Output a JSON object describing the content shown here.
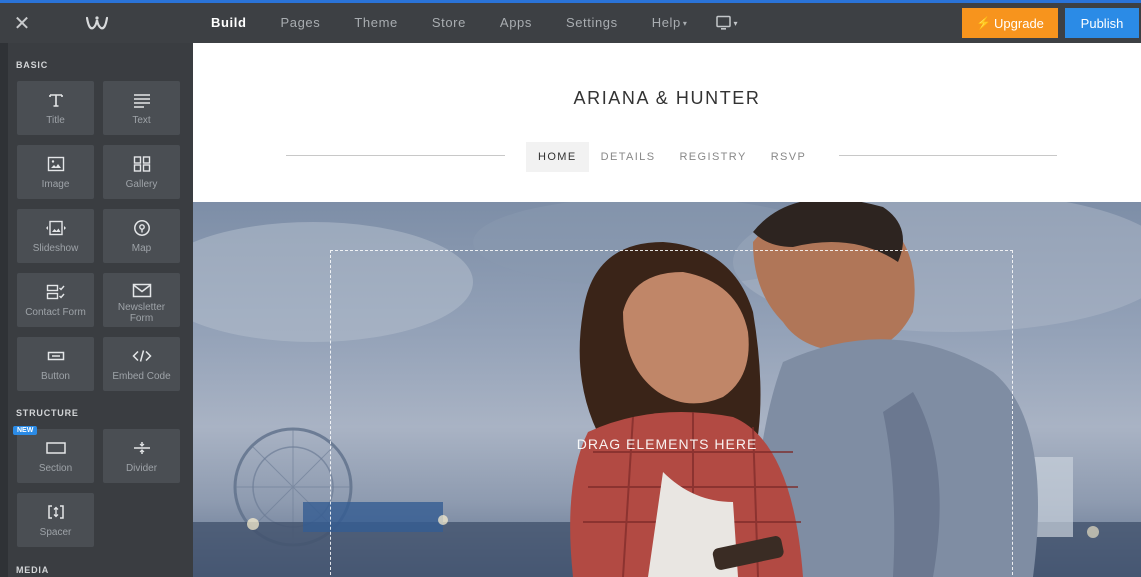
{
  "topbar": {
    "close_icon": "close-icon",
    "logo_icon": "weebly-logo-icon",
    "tabs": [
      {
        "label": "Build",
        "active": true
      },
      {
        "label": "Pages"
      },
      {
        "label": "Theme"
      },
      {
        "label": "Store"
      },
      {
        "label": "Apps"
      },
      {
        "label": "Settings"
      },
      {
        "label": "Help"
      }
    ],
    "device_icon": "monitor-icon",
    "upgrade_label": "Upgrade",
    "publish_label": "Publish",
    "colors": {
      "accent": "#2b8be6",
      "upgrade": "#f7941d",
      "bar": "#3d4044"
    }
  },
  "sidebar": {
    "basic_heading": "BASIC",
    "basic_items": [
      {
        "label": "Title",
        "icon": "title-icon"
      },
      {
        "label": "Text",
        "icon": "text-icon"
      },
      {
        "label": "Image",
        "icon": "image-icon"
      },
      {
        "label": "Gallery",
        "icon": "gallery-icon"
      },
      {
        "label": "Slideshow",
        "icon": "slideshow-icon"
      },
      {
        "label": "Map",
        "icon": "map-pin-icon"
      },
      {
        "label": "Contact Form",
        "icon": "contact-form-icon"
      },
      {
        "label": "Newsletter Form",
        "icon": "envelope-icon"
      },
      {
        "label": "Button",
        "icon": "button-icon"
      },
      {
        "label": "Embed Code",
        "icon": "code-icon"
      }
    ],
    "structure_heading": "STRUCTURE",
    "structure_items": [
      {
        "label": "Section",
        "icon": "section-icon",
        "badge": "NEW"
      },
      {
        "label": "Divider",
        "icon": "divider-icon"
      },
      {
        "label": "Spacer",
        "icon": "spacer-icon"
      }
    ],
    "media_heading": "MEDIA"
  },
  "site": {
    "title": "ARIANA & HUNTER",
    "nav": [
      {
        "label": "HOME",
        "active": true
      },
      {
        "label": "DETAILS"
      },
      {
        "label": "REGISTRY"
      },
      {
        "label": "RSVP"
      }
    ],
    "drop_text": "DRAG ELEMENTS HERE"
  }
}
